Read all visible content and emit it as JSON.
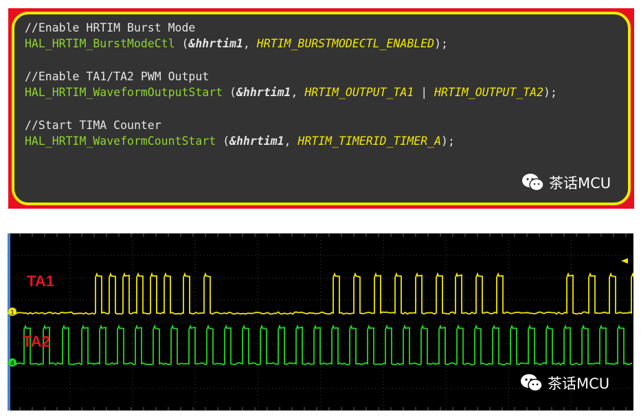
{
  "code": {
    "comment1": "//Enable HRTIM Burst Mode",
    "fn1": "HAL_HRTIM_BurstModeCtl",
    "open": " (",
    "amp_handle": "&hhrtim1",
    "sep": ", ",
    "arg1": "HRTIM_BURSTMODECTL_ENABLED",
    "close": ");",
    "comment2": "//Enable TA1/TA2 PWM Output",
    "fn2": "HAL_HRTIM_WaveformOutputStart",
    "arg2a": "HRTIM_OUTPUT_TA1",
    "pipe": " | ",
    "arg2b": "HRTIM_OUTPUT_TA2",
    "comment3": "//Start TIMA Counter",
    "fn3": "HAL_HRTIM_WaveformCountStart",
    "arg3": "HRTIM_TIMERID_TIMER_A"
  },
  "watermark": "茶话MCU",
  "scope": {
    "ch1_label": "TA1",
    "ch2_label": "TA2",
    "ch1_marker": "1",
    "ch2_marker": "4",
    "ch1_color": "#f2e900",
    "ch2_color": "#22d822",
    "ta1_pulse_groups": [
      [
        128,
        148,
        168,
        188,
        208,
        228,
        256,
        286
      ],
      [
        474,
        504,
        534,
        564,
        594,
        624,
        652,
        682,
        712
      ],
      [
        814,
        846,
        876,
        908
      ]
    ],
    "ta2_pulse_positions": [
      24,
      52,
      80,
      108,
      134,
      160,
      186,
      212,
      238,
      264,
      290,
      316,
      342,
      368,
      394,
      420,
      446,
      472,
      498,
      524,
      550,
      576,
      602,
      628,
      654,
      680,
      706,
      732,
      758,
      784,
      810,
      836,
      862,
      888
    ]
  }
}
